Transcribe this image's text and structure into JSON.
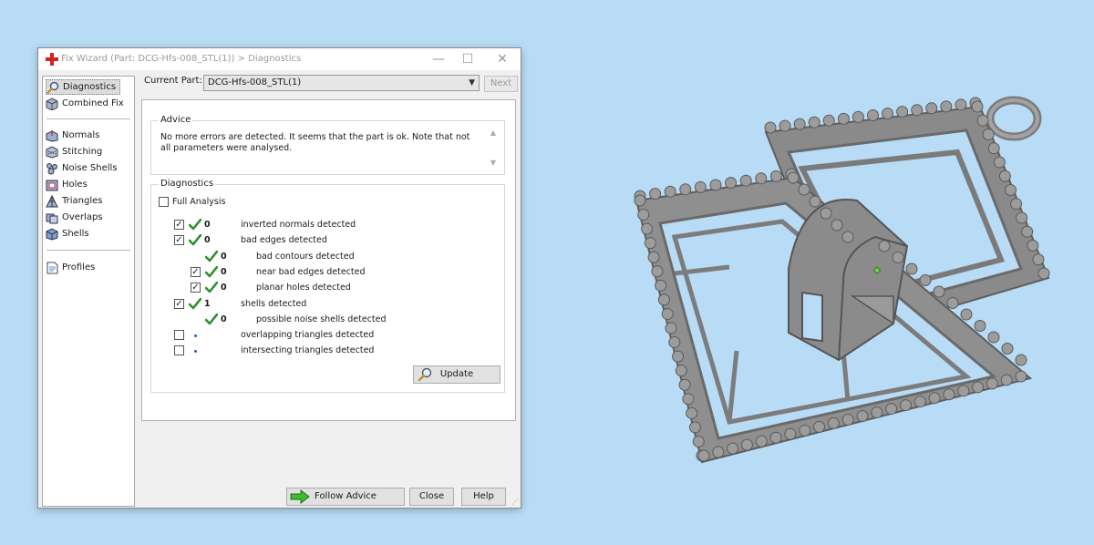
{
  "window": {
    "title": "Fix Wizard (Part: DCG-Hfs-008_STL(1)) > Diagnostics",
    "controls": {
      "minimize": "—",
      "maximize": "☐",
      "close": "✕"
    }
  },
  "sidebar": {
    "items": [
      {
        "label": "Diagnostics",
        "icon": "magnifier-icon",
        "selected": true
      },
      {
        "label": "Combined Fix",
        "icon": "cube-icon"
      },
      {
        "label": "Normals",
        "icon": "normals-icon"
      },
      {
        "label": "Stitching",
        "icon": "stitching-icon"
      },
      {
        "label": "Noise Shells",
        "icon": "noise-shells-icon"
      },
      {
        "label": "Holes",
        "icon": "holes-icon"
      },
      {
        "label": "Triangles",
        "icon": "triangles-icon"
      },
      {
        "label": "Overlaps",
        "icon": "overlaps-icon"
      },
      {
        "label": "Shells",
        "icon": "shells-icon"
      },
      {
        "label": "Profiles",
        "icon": "profiles-icon"
      }
    ]
  },
  "current_part": {
    "label": "Current Part:",
    "value": "DCG-Hfs-008_STL(1)",
    "next_label": "Next"
  },
  "advice": {
    "title": "Advice",
    "text": "No more errors are detected. It seems that the part is ok. Note that not all parameters were analysed."
  },
  "diagnostics": {
    "title": "Diagnostics",
    "full_analysis_label": "Full Analysis",
    "full_analysis_checked": false,
    "rows": [
      {
        "checkbox": true,
        "checked": true,
        "status": "ok",
        "count": "0",
        "label": "inverted normals detected",
        "indent": 0
      },
      {
        "checkbox": true,
        "checked": true,
        "status": "ok",
        "count": "0",
        "label": "bad edges detected",
        "indent": 0
      },
      {
        "checkbox": false,
        "checked": false,
        "status": "ok",
        "count": "0",
        "label": "bad contours detected",
        "indent": 1
      },
      {
        "checkbox": true,
        "checked": true,
        "status": "ok",
        "count": "0",
        "label": "near bad edges detected",
        "indent": 1
      },
      {
        "checkbox": true,
        "checked": true,
        "status": "ok",
        "count": "0",
        "label": "planar holes detected",
        "indent": 1
      },
      {
        "checkbox": true,
        "checked": true,
        "status": "ok",
        "count": "1",
        "label": "shells detected",
        "indent": 0
      },
      {
        "checkbox": false,
        "checked": false,
        "status": "ok",
        "count": "0",
        "label": "possible noise shells detected",
        "indent": 1
      },
      {
        "checkbox": true,
        "checked": false,
        "status": "none",
        "count": "",
        "label": "overlapping triangles detected",
        "indent": 0
      },
      {
        "checkbox": true,
        "checked": false,
        "status": "none",
        "count": "",
        "label": "intersecting triangles detected",
        "indent": 0
      }
    ],
    "update_label": "Update"
  },
  "footer": {
    "follow_advice_label": "Follow Advice",
    "close_label": "Close",
    "help_label": "Help"
  },
  "colors": {
    "desktop": "#b8dcf6",
    "check_green": "#2f8f2f",
    "model_gray": "#8e8e8e"
  }
}
